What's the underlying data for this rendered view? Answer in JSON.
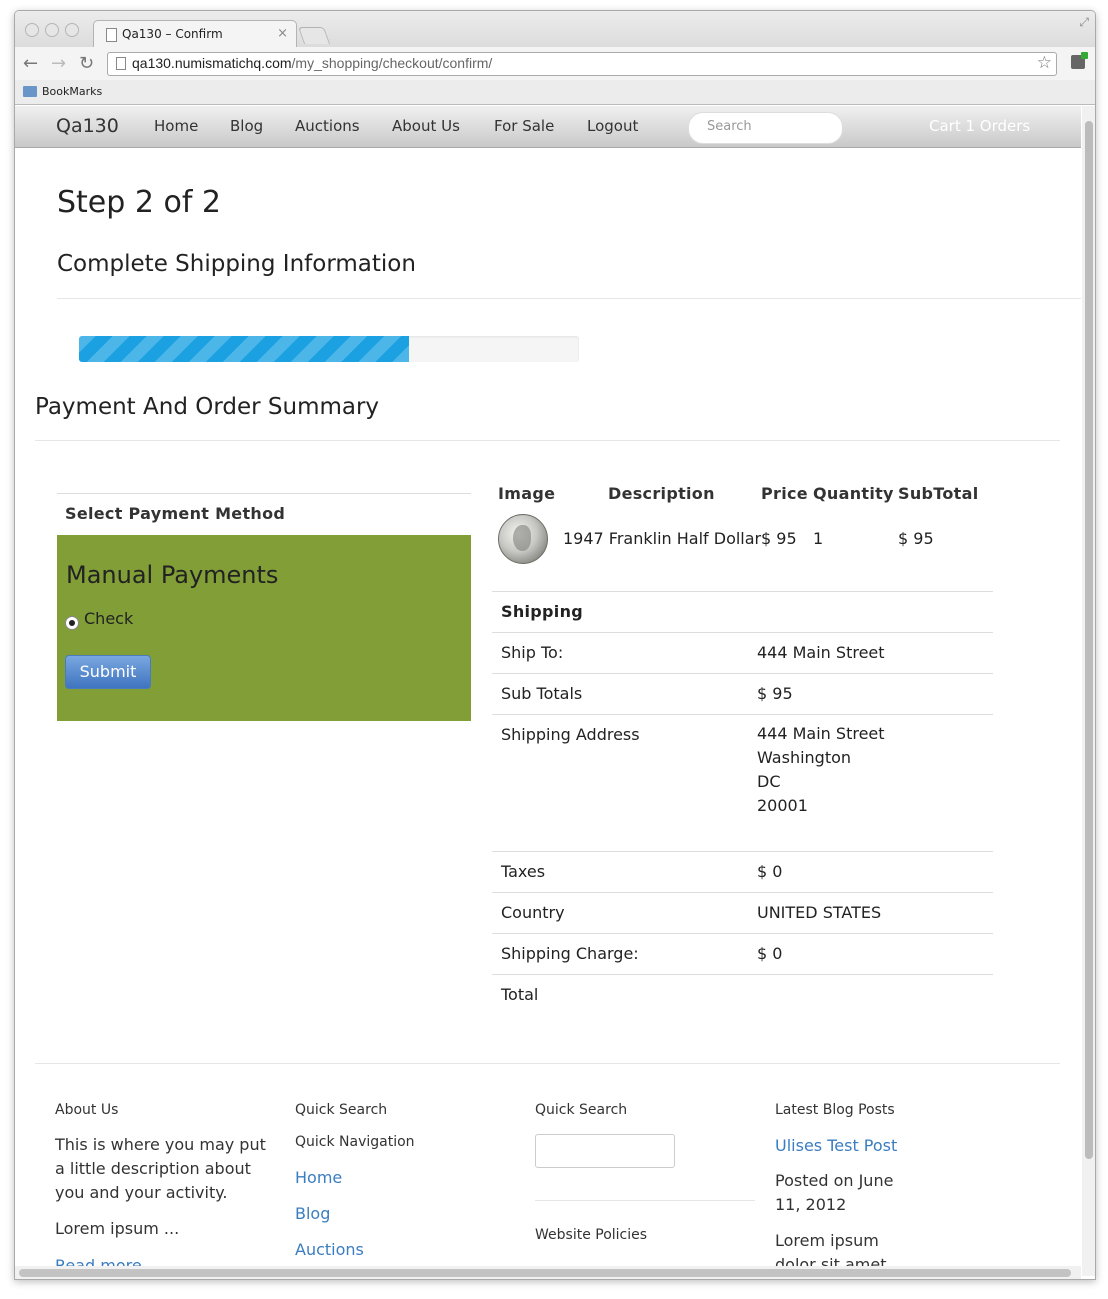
{
  "browser": {
    "tab_title": "Qa130 – Confirm",
    "tab_close": "×",
    "url_host": "qa130.numismatichq.com",
    "url_path": "/my_shopping/checkout/confirm/",
    "bookmarks_label": "BookMarks"
  },
  "nav": {
    "brand": "Qa130",
    "links": [
      "Home",
      "Blog",
      "Auctions",
      "About Us",
      "For Sale",
      "Logout"
    ],
    "search_placeholder": "Search",
    "cart": "Cart 1  Orders"
  },
  "page": {
    "step_title": "Step 2 of 2",
    "subtitle": "Complete Shipping Information",
    "progress_fraction": 0.66,
    "summary_title": "Payment And Order Summary"
  },
  "payment": {
    "header": "Select Payment Method",
    "panel_title": "Manual Payments",
    "option_label": "Check",
    "submit_label": "Submit",
    "panel_color": "#819e37"
  },
  "cart": {
    "headers": [
      "Image",
      "Description",
      "Price",
      "Quantity",
      "SubTotal"
    ],
    "item": {
      "description": "1947 Franklin Half Dollar",
      "price": "$ 95",
      "quantity": "1",
      "subtotal": "$ 95"
    }
  },
  "summary": {
    "shipping_heading": "Shipping",
    "rows": [
      {
        "label": "Ship To:",
        "value": "444 Main Street"
      },
      {
        "label": "Sub Totals",
        "value": "$ 95"
      },
      {
        "label": "Shipping Address",
        "value_lines": [
          "444 Main Street",
          "Washington",
          "DC",
          "20001"
        ]
      },
      {
        "label": "Taxes",
        "value": "$ 0"
      },
      {
        "label": "Country",
        "value": "UNITED STATES"
      },
      {
        "label": "Shipping Charge:",
        "value": "$ 0"
      },
      {
        "label": "Total",
        "value": ""
      }
    ]
  },
  "footer": {
    "about": {
      "heading": "About Us",
      "text": "This is where you may put a little description about you and your activity.",
      "lorem": "Lorem ipsum ...",
      "read_more": "Read more"
    },
    "quick_search_1": {
      "heading": "Quick Search",
      "subheading": "Quick Navigation",
      "links": [
        "Home",
        "Blog",
        "Auctions"
      ]
    },
    "quick_search_2": {
      "heading": "Quick Search",
      "policies": "Website Policies"
    },
    "blog": {
      "heading": "Latest Blog Posts",
      "post_link": "Ulises Test Post",
      "posted": "Posted on June 11, 2012",
      "lorem": "Lorem ipsum dolor sit amet"
    }
  }
}
